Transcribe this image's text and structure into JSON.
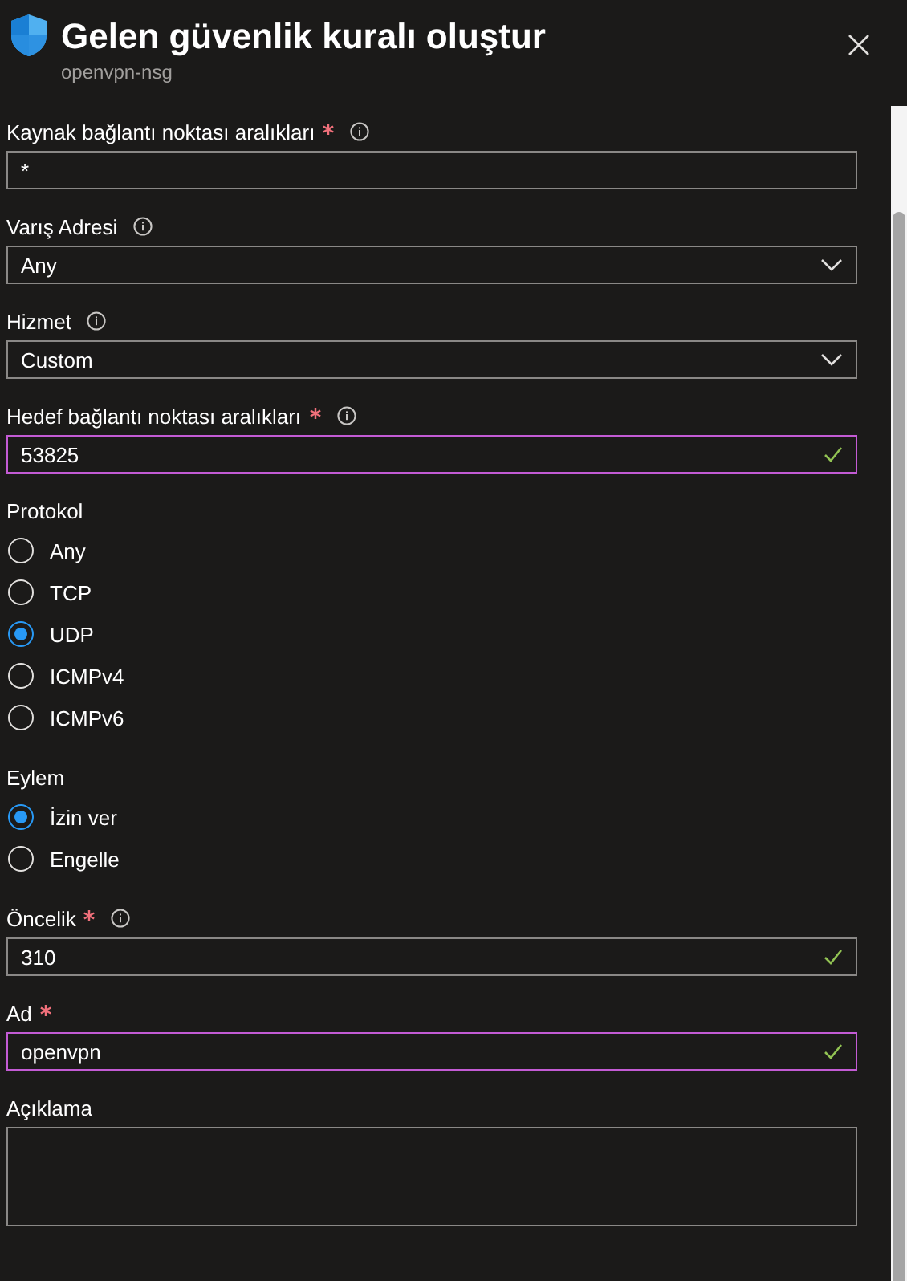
{
  "header": {
    "title": "Gelen güvenlik kuralı oluştur",
    "subtitle": "openvpn-nsg"
  },
  "fields": [
    {
      "kind": "text",
      "label": "Kaynak bağlantı noktası aralıkları",
      "required": true,
      "info": true,
      "value": "*",
      "focused": false,
      "valid": false
    },
    {
      "kind": "select",
      "label": "Varış Adresi",
      "info": true,
      "value": "Any",
      "focused": false,
      "valid": false
    },
    {
      "kind": "select",
      "label": "Hizmet",
      "info": true,
      "value": "Custom",
      "focused": false,
      "valid": false
    },
    {
      "kind": "text",
      "label": "Hedef bağlantı noktası aralıkları",
      "required": true,
      "info": true,
      "value": "53825",
      "focused": true,
      "valid": true
    },
    {
      "kind": "radio",
      "label": "Protokol",
      "options": [
        {
          "label": "Any",
          "selected": false
        },
        {
          "label": "TCP",
          "selected": false
        },
        {
          "label": "UDP",
          "selected": true
        },
        {
          "label": "ICMPv4",
          "selected": false
        },
        {
          "label": "ICMPv6",
          "selected": false
        }
      ]
    },
    {
      "kind": "radio",
      "label": "Eylem",
      "options": [
        {
          "label": "İzin ver",
          "selected": true
        },
        {
          "label": "Engelle",
          "selected": false
        }
      ]
    },
    {
      "kind": "text",
      "label": "Öncelik",
      "required": true,
      "info": true,
      "value": "310",
      "focused": false,
      "valid": true
    },
    {
      "kind": "text",
      "label": "Ad",
      "required": true,
      "value": "openvpn",
      "focused": true,
      "valid": true
    },
    {
      "kind": "textarea",
      "label": "Açıklama"
    }
  ]
}
